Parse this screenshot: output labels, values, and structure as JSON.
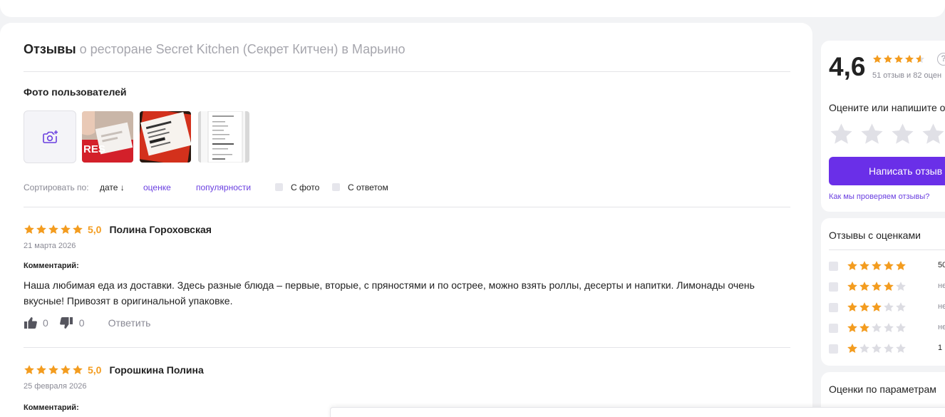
{
  "header": {
    "title_bold": "Отзывы",
    "title_rest": "о ресторане Secret Kitchen (Секрет Китчен) в Марьино"
  },
  "photos": {
    "title": "Фото пользователей",
    "add_icon": "camera-plus-icon",
    "thumbnail_count": 3
  },
  "sort": {
    "label": "Сортировать по:",
    "options": [
      "дате",
      "оценке",
      "популярности"
    ],
    "active": "дате",
    "active_arrow": "↓",
    "filters": [
      "С фото",
      "С ответом"
    ]
  },
  "reviews": [
    {
      "rating": 5,
      "rating_text": "5,0",
      "author": "Полина Гороховская",
      "date": "21 марта 2026",
      "comment_label": "Комментарий:",
      "comment": "Наша любимая еда из доставки. Здесь разные блюда – первые, вторые, с пряностями и по острее, можно взять роллы, десерты и напитки. Лимонады очень вкусные! Привозят в оригинальной упаковке.",
      "likes": "0",
      "dislikes": "0",
      "reply_label": "Ответить"
    },
    {
      "rating": 5,
      "rating_text": "5,0",
      "author": "Горошкина Полина",
      "date": "25 февраля 2026",
      "comment_label": "Комментарий:"
    }
  ],
  "summary": {
    "rating": "4,6",
    "rating_value": 4.6,
    "counts": "51 отзыв и 82 оцен",
    "help": "?",
    "rate_prompt": "Оцените или напишите о",
    "write_button": "Написать отзыв",
    "verify_link": "Как мы проверяем отзывы?"
  },
  "rating_filter": {
    "title": "Отзывы с оценками",
    "rows": [
      {
        "stars": 5,
        "count": "50"
      },
      {
        "stars": 4,
        "count": "не"
      },
      {
        "stars": 3,
        "count": "не"
      },
      {
        "stars": 2,
        "count": "не"
      },
      {
        "stars": 1,
        "count": "1"
      }
    ]
  },
  "params": {
    "title": "Оценки по параметрам"
  },
  "colors": {
    "accent": "#6a2fe8",
    "link": "#6a3fe0",
    "star": "#f39c1f",
    "star_empty": "#dcdce2",
    "muted": "#8a8a95"
  }
}
